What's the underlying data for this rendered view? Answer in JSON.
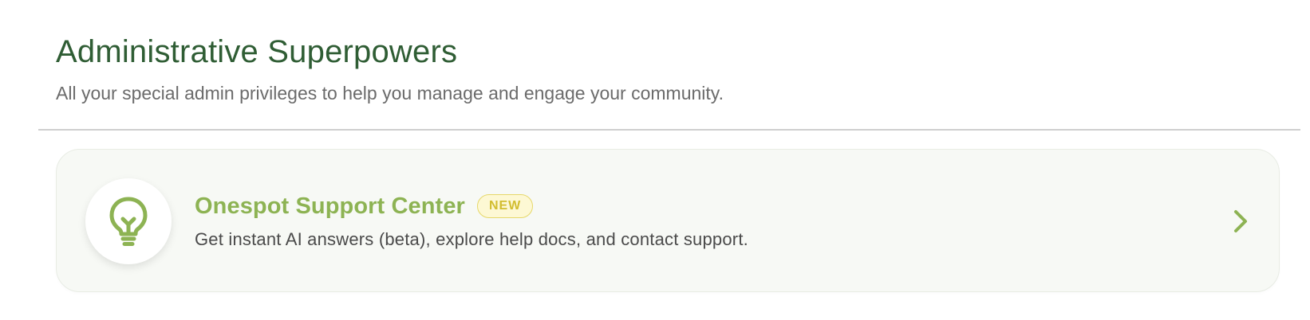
{
  "header": {
    "title": "Administrative Superpowers",
    "subtitle": "All your special admin privileges to help you manage and engage your community."
  },
  "card": {
    "icon": "lightbulb-icon",
    "title": "Onespot Support Center",
    "badge": "NEW",
    "description": "Get instant AI answers (beta), explore help docs, and contact support.",
    "action_icon": "chevron-right-icon"
  },
  "colors": {
    "title": "#2f5d34",
    "accent_green": "#8db353",
    "badge_bg": "#fdf8d4",
    "badge_text": "#d2bd2f",
    "card_bg": "#f7f9f5"
  }
}
